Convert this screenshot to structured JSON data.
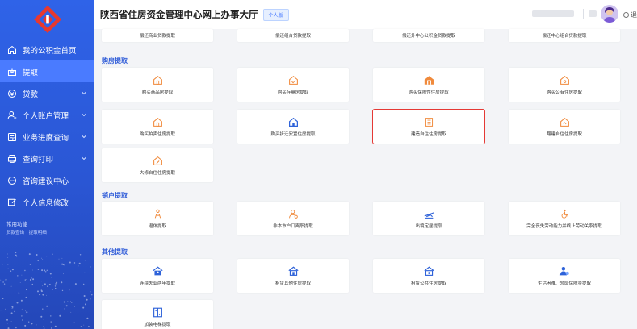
{
  "header": {
    "title": "陕西省住房资金管理中心网上办事大厅",
    "tag": "个人版",
    "logout": "退"
  },
  "sidebar": {
    "items": [
      {
        "label": "我的公积金首页",
        "icon": "home-icon",
        "active": false,
        "chevron": false
      },
      {
        "label": "提取",
        "icon": "withdraw-icon",
        "active": true,
        "chevron": false
      },
      {
        "label": "贷款",
        "icon": "loan-icon",
        "active": false,
        "chevron": true
      },
      {
        "label": "个人账户管理",
        "icon": "account-icon",
        "active": false,
        "chevron": true
      },
      {
        "label": "业务进度查询",
        "icon": "progress-icon",
        "active": false,
        "chevron": true
      },
      {
        "label": "查询打印",
        "icon": "print-icon",
        "active": false,
        "chevron": true
      },
      {
        "label": "咨询建议中心",
        "icon": "consult-icon",
        "active": false,
        "chevron": false
      },
      {
        "label": "个人信息修改",
        "icon": "edit-icon",
        "active": false,
        "chevron": false
      }
    ],
    "quick_title": "常用功能",
    "quick_links": [
      "贷款查询",
      "提取明细"
    ]
  },
  "sections": [
    {
      "title": ""
    },
    {
      "title": "购房提取"
    },
    {
      "title": "销户提取"
    },
    {
      "title": "其他提取"
    }
  ],
  "top_cards": [
    "偿还商业贷款提取",
    "偿还组合贷款提取",
    "偿还外中心公积金贷款提取",
    "偿还中心组合贷款提取"
  ],
  "purchase_cards": [
    {
      "label": "购买商品房提取",
      "icon": "house-icon"
    },
    {
      "label": "购买存量房提取",
      "icon": "house-check-icon"
    },
    {
      "label": "购买保障性住房提取",
      "icon": "house-shield-icon"
    },
    {
      "label": "购买公有住房提取",
      "icon": "house-key-icon"
    },
    {
      "label": "购买拍卖住房提取",
      "icon": "house-icon"
    },
    {
      "label": "购买拆迁安置住房提取",
      "icon": "house-dot-icon"
    },
    {
      "label": "建造自住住房提取",
      "icon": "building-icon"
    },
    {
      "label": "翻建自住住房提取",
      "icon": "house-arrow-icon"
    },
    {
      "label": "大修自住住房提取",
      "icon": "house-tool-icon"
    }
  ],
  "closing_cards": [
    {
      "label": "退休提取",
      "icon": "retire-icon"
    },
    {
      "label": "非本市户口离职提取",
      "icon": "person-leave-icon"
    },
    {
      "label": "出境定居提取",
      "icon": "plane-icon"
    },
    {
      "label": "完全丧失劳动能力并终止劳动关系提取",
      "icon": "disability-icon"
    }
  ],
  "other_cards": [
    {
      "label": "连续失业两年提取",
      "icon": "house-person-icon"
    },
    {
      "label": "租赁其他住房提取",
      "icon": "house-rent-icon"
    },
    {
      "label": "租赁公共住房提取",
      "icon": "house-public-icon"
    },
    {
      "label": "生活困难、领取保障金提取",
      "icon": "hardship-icon"
    },
    {
      "label": "加装电梯提取",
      "icon": "elevator-icon"
    }
  ],
  "colors": {
    "sidebar": "#2f63e8",
    "accent": "#4a7bff",
    "orange": "#f08a3c",
    "blue_icon": "#2e62d9",
    "highlight": "#e53935"
  }
}
